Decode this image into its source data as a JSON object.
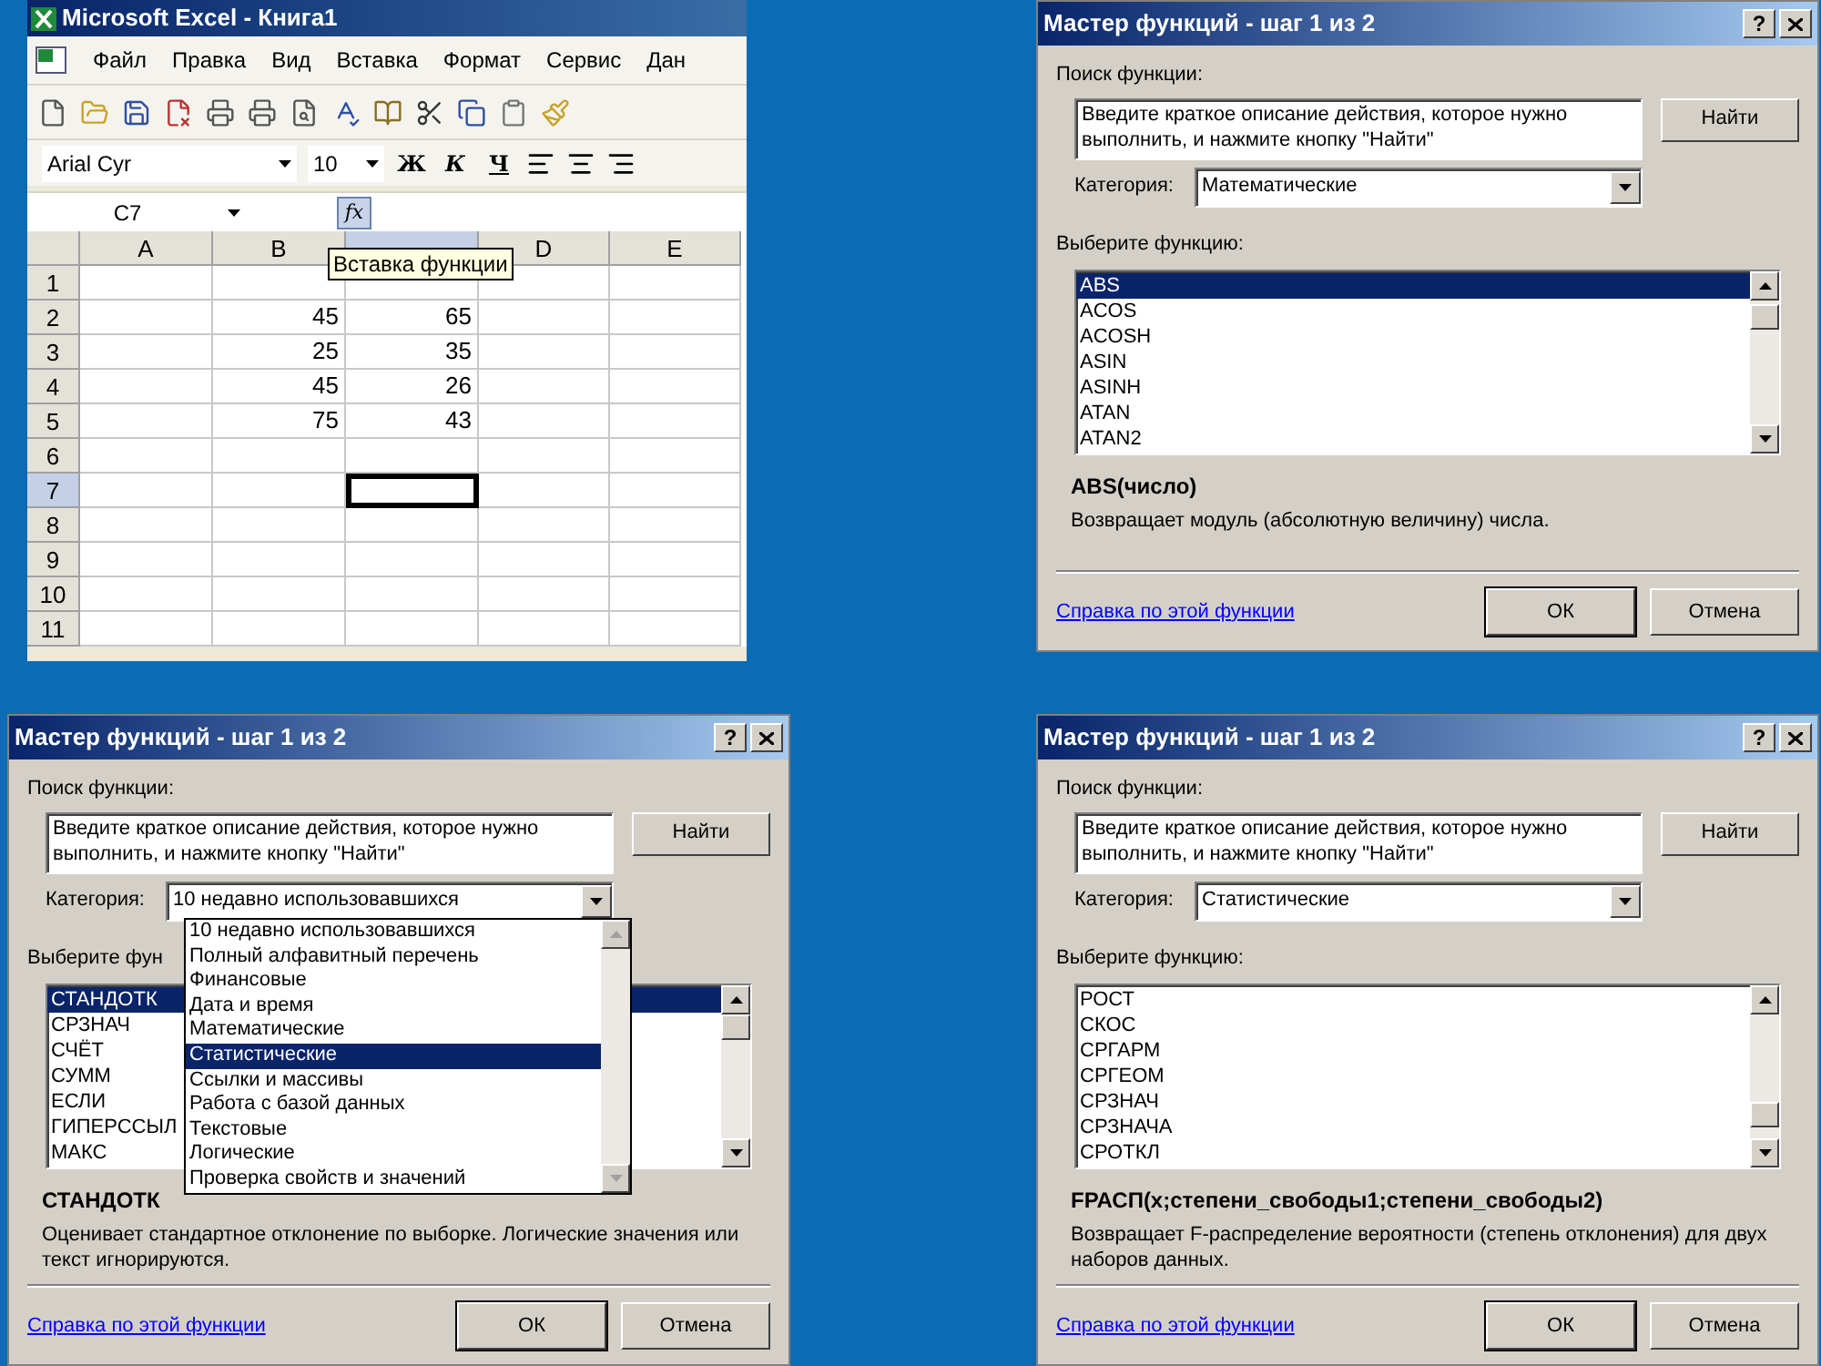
{
  "excel": {
    "title": "Microsoft Excel - Книга1",
    "menu": [
      "Файл",
      "Правка",
      "Вид",
      "Вставка",
      "Формат",
      "Сервис",
      "Дан"
    ],
    "font_name": "Arial Cyr",
    "font_size": "10",
    "format_buttons": [
      "Ж",
      "К",
      "Ч"
    ],
    "name_box": "C7",
    "formula_button": "fx",
    "tooltip": "Вставка функции",
    "columns": [
      {
        "label": "A",
        "selected": false
      },
      {
        "label": "B",
        "selected": false
      },
      {
        "selected": true
      },
      {
        "label": "D",
        "selected": false
      },
      {
        "label": "E",
        "selected": false
      }
    ],
    "rows": [
      {
        "number": "1",
        "selected": false,
        "cells": [
          null,
          null,
          null,
          null,
          null
        ]
      },
      {
        "number": "2",
        "selected": false,
        "cells": [
          null,
          "45",
          "65",
          null,
          null
        ]
      },
      {
        "number": "3",
        "selected": false,
        "cells": [
          null,
          "25",
          "35",
          null,
          null
        ]
      },
      {
        "number": "4",
        "selected": false,
        "cells": [
          null,
          "45",
          "26",
          null,
          null
        ]
      },
      {
        "number": "5",
        "selected": false,
        "cells": [
          null,
          "75",
          "43",
          null,
          null
        ]
      },
      {
        "number": "6",
        "selected": false,
        "cells": [
          null,
          null,
          null,
          null,
          null
        ]
      },
      {
        "number": "7",
        "selected": true,
        "cells": [
          null,
          null,
          null,
          null,
          null
        ]
      },
      {
        "number": "8",
        "selected": false,
        "cells": [
          null,
          null,
          null,
          null,
          null
        ]
      },
      {
        "number": "9",
        "selected": false,
        "cells": [
          null,
          null,
          null,
          null,
          null
        ]
      },
      {
        "number": "10",
        "selected": false,
        "cells": [
          null,
          null,
          null,
          null,
          null
        ]
      },
      {
        "number": "11",
        "selected": false,
        "cells": [
          null,
          null,
          null,
          null,
          null
        ]
      }
    ]
  },
  "dialogs": [
    {
      "title": "Мастер функций - шаг 1 из 2",
      "help_button": "?",
      "search_label": "Поиск функции:",
      "search_text": "Введите краткое описание действия, которое нужно выполнить, и нажмите кнопку \"Найти\"",
      "find_button": "Найти",
      "category_label": "Категория:",
      "category_value": "Математические",
      "list_label": "Выберите функцию:",
      "functions": [
        {
          "name": "ABS",
          "selected": true
        },
        {
          "name": "ACOS",
          "selected": false
        },
        {
          "name": "ACOSH",
          "selected": false
        },
        {
          "name": "ASIN",
          "selected": false
        },
        {
          "name": "ASINH",
          "selected": false
        },
        {
          "name": "ATAN",
          "selected": false
        },
        {
          "name": "ATAN2",
          "selected": false
        }
      ],
      "signature": "ABS(число)",
      "description": "Возвращает модуль (абсолютную величину) числа.",
      "help_link": "Справка по этой функции",
      "ok_button": "ОК",
      "cancel_button": "Отмена"
    },
    {
      "title": "Мастер функций - шаг 1 из 2",
      "help_button": "?",
      "search_label": "Поиск функции:",
      "search_text": "Введите краткое описание действия, которое нужно выполнить, и нажмите кнопку \"Найти\"",
      "find_button": "Найти",
      "category_label": "Категория:",
      "category_value": "10 недавно использовавшихся",
      "list_label": "Выберите фун",
      "functions": [
        {
          "name": "СТАНДОТК",
          "selected": true
        },
        {
          "name": "СРЗНАЧ",
          "selected": false
        },
        {
          "name": "СЧЁТ",
          "selected": false
        },
        {
          "name": "СУММ",
          "selected": false
        },
        {
          "name": "ЕСЛИ",
          "selected": false
        },
        {
          "name": "ГИПЕРССЫЛ",
          "selected": false
        },
        {
          "name": "МАКС",
          "selected": false
        }
      ],
      "signature": "СТАНДОТК",
      "description": "Оценивает стандартное отклонение по выборке. Логические значения или текст игнорируются.",
      "help_link": "Справка по этой функции",
      "ok_button": "ОК",
      "cancel_button": "Отмена",
      "dropdown": [
        {
          "label": "10 недавно использовавшихся",
          "selected": false
        },
        {
          "label": "Полный алфавитный перечень",
          "selected": false
        },
        {
          "label": "Финансовые",
          "selected": false
        },
        {
          "label": "Дата и время",
          "selected": false
        },
        {
          "label": "Математические",
          "selected": false
        },
        {
          "label": "Статистические",
          "selected": true
        },
        {
          "label": "Ссылки и массивы",
          "selected": false
        },
        {
          "label": "Работа с базой данных",
          "selected": false
        },
        {
          "label": "Текстовые",
          "selected": false
        },
        {
          "label": "Логические",
          "selected": false
        },
        {
          "label": "Проверка свойств и значений",
          "selected": false
        }
      ]
    },
    {
      "title": "Мастер функций - шаг 1 из 2",
      "help_button": "?",
      "search_label": "Поиск функции:",
      "search_text": "Введите краткое описание действия, которое нужно выполнить, и нажмите кнопку \"Найти\"",
      "find_button": "Найти",
      "category_label": "Категория:",
      "category_value": "Статистические",
      "list_label": "Выберите функцию:",
      "functions": [
        {
          "name": "РОСТ",
          "selected": false
        },
        {
          "name": "СКОС",
          "selected": false
        },
        {
          "name": "СРГАРМ",
          "selected": false
        },
        {
          "name": "СРГЕОМ",
          "selected": false
        },
        {
          "name": "СРЗНАЧ",
          "selected": false
        },
        {
          "name": "СРЗНАЧА",
          "selected": false
        },
        {
          "name": "СРОТКЛ",
          "selected": false
        }
      ],
      "signature": "FРАСП(x;степени_свободы1;степени_свободы2)",
      "description": "Возвращает F-распределение вероятности (степень отклонения) для двух наборов данных.",
      "help_link": "Справка по этой функции",
      "ok_button": "ОК",
      "cancel_button": "Отмена"
    }
  ]
}
